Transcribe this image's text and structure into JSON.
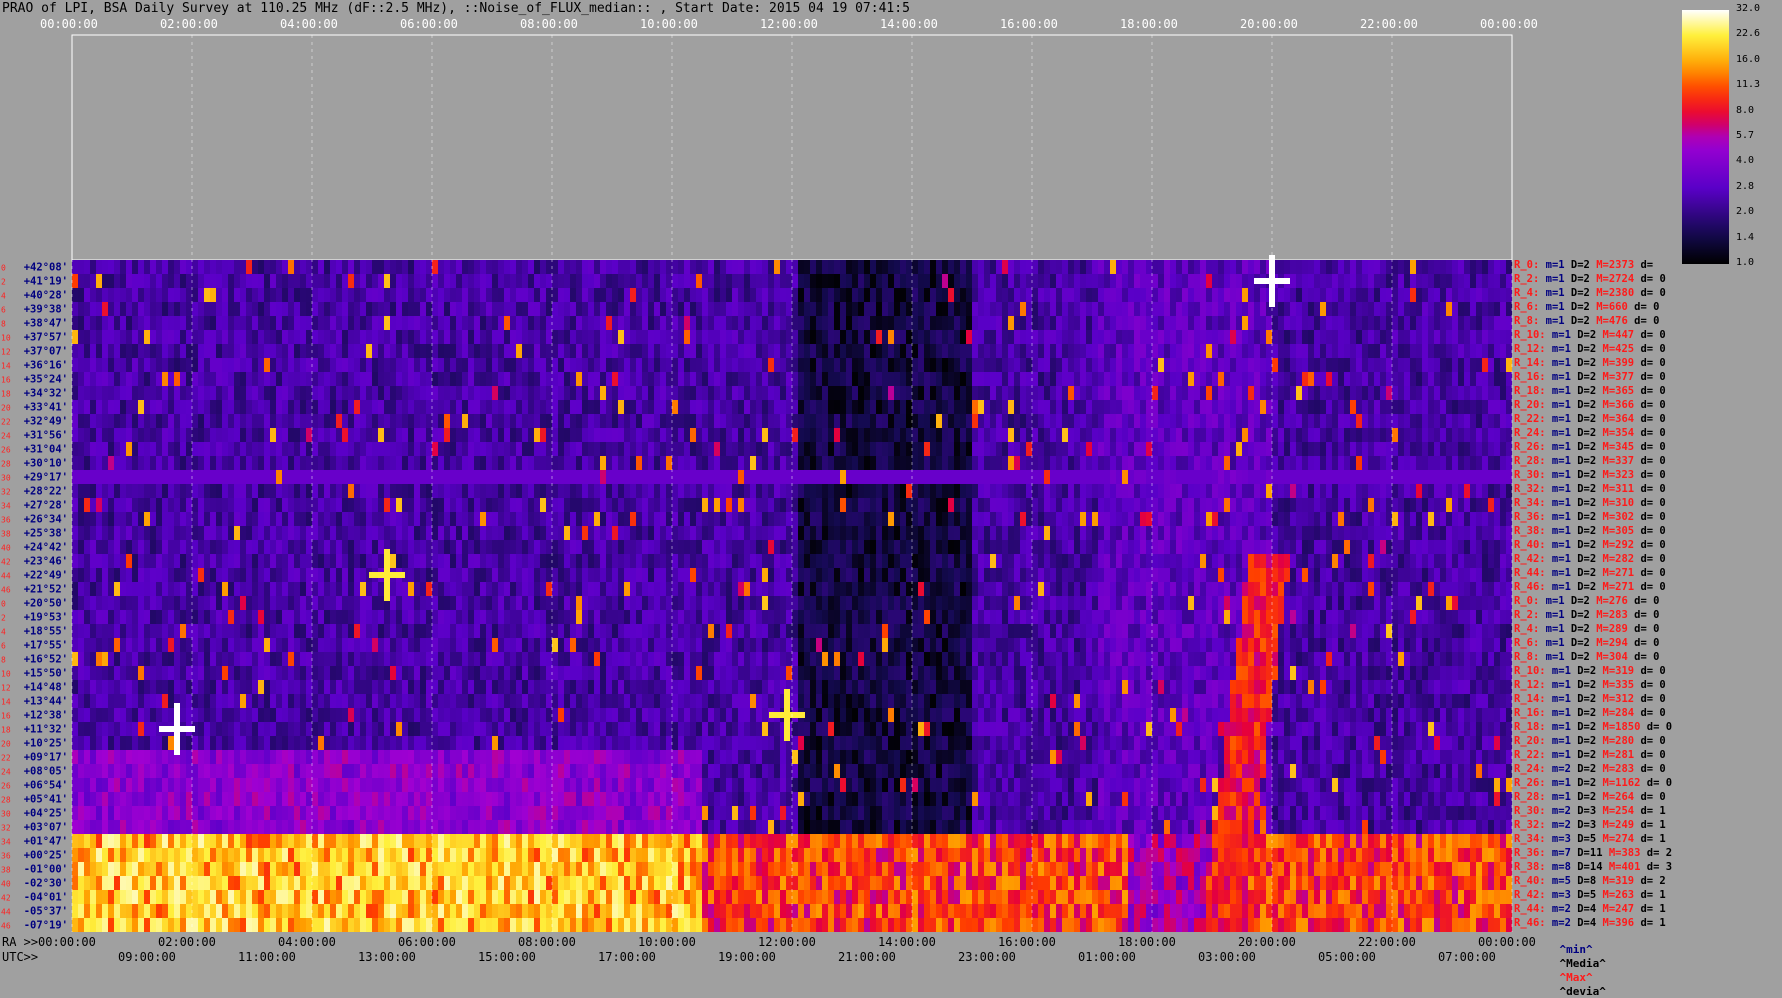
{
  "title": "PRAO of LPI, BSA Daily Survey at 110.25 MHz (dF::2.5 MHz), ::Noise_of_FLUX_median:: , Start Date: 2015 04 19 07:41:5",
  "ra_top_ticks": [
    "00:00:00",
    "02:00:00",
    "04:00:00",
    "06:00:00",
    "08:00:00",
    "10:00:00",
    "12:00:00",
    "14:00:00",
    "16:00:00",
    "18:00:00",
    "20:00:00",
    "22:00:00",
    "00:00:00"
  ],
  "ra_bottom_label": "RA >>",
  "ra_bottom_ticks": [
    "00:00:00",
    "02:00:00",
    "04:00:00",
    "06:00:00",
    "08:00:00",
    "10:00:00",
    "12:00:00",
    "14:00:00",
    "16:00:00",
    "18:00:00",
    "20:00:00",
    "22:00:00",
    "00:00:00"
  ],
  "utc_label": "UTC>>",
  "utc_ticks": [
    "09:00:00",
    "11:00:00",
    "13:00:00",
    "15:00:00",
    "17:00:00",
    "19:00:00",
    "21:00:00",
    "23:00:00",
    "01:00:00",
    "03:00:00",
    "05:00:00",
    "07:00:00"
  ],
  "colorbar_ticks": [
    "32.0",
    "22.6",
    "16.0",
    "11.3",
    "8.0",
    "5.7",
    "4.0",
    "2.8",
    "2.0",
    "1.4",
    "1.0"
  ],
  "colors": {
    "background": "#a0a0a0",
    "dec_label": "#000080",
    "row_label": "#ff2020"
  },
  "legend": {
    "min": "^min^",
    "median": "^Media^",
    "max": "^Max^",
    "dev": "^devia^"
  },
  "chart_data": {
    "type": "heatmap",
    "declinations": [
      "+42°08'",
      "+41°19'",
      "+40°28'",
      "+39°38'",
      "+38°47'",
      "+37°57'",
      "+37°07'",
      "+36°16'",
      "+35°24'",
      "+34°32'",
      "+33°41'",
      "+32°49'",
      "+31°56'",
      "+31°04'",
      "+30°10'",
      "+29°17'",
      "+28°22'",
      "+27°28'",
      "+26°34'",
      "+25°38'",
      "+24°42'",
      "+23°46'",
      "+22°49'",
      "+21°52'",
      "+20°50'",
      "+19°53'",
      "+18°55'",
      "+17°55'",
      "+16°52'",
      "+15°50'",
      "+14°48'",
      "+13°44'",
      "+12°38'",
      "+11°32'",
      "+10°25'",
      "+09°17'",
      "+08°05'",
      "+06°54'",
      "+05°41'",
      "+04°25'",
      "+03°07'",
      "+01°47'",
      "+00°25'",
      "-01°00'",
      "-02°30'",
      "-04°01'",
      "-05°37'",
      "-07°19'"
    ],
    "row_numbers": [
      "0",
      "2",
      "4",
      "6",
      "8",
      "10",
      "12",
      "14",
      "16",
      "18",
      "20",
      "22",
      "24",
      "26",
      "28",
      "30",
      "32",
      "34",
      "36",
      "38",
      "40",
      "42",
      "44",
      "46",
      "0",
      "2",
      "4",
      "6",
      "8",
      "10",
      "12",
      "14",
      "16",
      "18",
      "20",
      "22",
      "24",
      "26",
      "28",
      "30",
      "32",
      "34",
      "36",
      "38",
      "40",
      "42",
      "44",
      "46"
    ],
    "stats": [
      {
        "r": "R_0:",
        "m": "m=1",
        "D": "D=2",
        "M": "M=2373",
        "d": "d="
      },
      {
        "r": "R_2:",
        "m": "m=1",
        "D": "D=2",
        "M": "M=2724",
        "d": "d= 0"
      },
      {
        "r": "R_4:",
        "m": "m=1",
        "D": "D=2",
        "M": "M=2380",
        "d": "d= 0"
      },
      {
        "r": "R_6:",
        "m": "m=1",
        "D": "D=2",
        "M": "M=660",
        "d": "d= 0"
      },
      {
        "r": "R_8:",
        "m": "m=1",
        "D": "D=2",
        "M": "M=476",
        "d": "d= 0"
      },
      {
        "r": "R_10:",
        "m": "m=1",
        "D": "D=2",
        "M": "M=447",
        "d": "d= 0"
      },
      {
        "r": "R_12:",
        "m": "m=1",
        "D": "D=2",
        "M": "M=425",
        "d": "d= 0"
      },
      {
        "r": "R_14:",
        "m": "m=1",
        "D": "D=2",
        "M": "M=399",
        "d": "d= 0"
      },
      {
        "r": "R_16:",
        "m": "m=1",
        "D": "D=2",
        "M": "M=377",
        "d": "d= 0"
      },
      {
        "r": "R_18:",
        "m": "m=1",
        "D": "D=2",
        "M": "M=365",
        "d": "d= 0"
      },
      {
        "r": "R_20:",
        "m": "m=1",
        "D": "D=2",
        "M": "M=366",
        "d": "d= 0"
      },
      {
        "r": "R_22:",
        "m": "m=1",
        "D": "D=2",
        "M": "M=364",
        "d": "d= 0"
      },
      {
        "r": "R_24:",
        "m": "m=1",
        "D": "D=2",
        "M": "M=354",
        "d": "d= 0"
      },
      {
        "r": "R_26:",
        "m": "m=1",
        "D": "D=2",
        "M": "M=345",
        "d": "d= 0"
      },
      {
        "r": "R_28:",
        "m": "m=1",
        "D": "D=2",
        "M": "M=337",
        "d": "d= 0"
      },
      {
        "r": "R_30:",
        "m": "m=1",
        "D": "D=2",
        "M": "M=323",
        "d": "d= 0"
      },
      {
        "r": "R_32:",
        "m": "m=1",
        "D": "D=2",
        "M": "M=311",
        "d": "d= 0"
      },
      {
        "r": "R_34:",
        "m": "m=1",
        "D": "D=2",
        "M": "M=310",
        "d": "d= 0"
      },
      {
        "r": "R_36:",
        "m": "m=1",
        "D": "D=2",
        "M": "M=302",
        "d": "d= 0"
      },
      {
        "r": "R_38:",
        "m": "m=1",
        "D": "D=2",
        "M": "M=305",
        "d": "d= 0"
      },
      {
        "r": "R_40:",
        "m": "m=1",
        "D": "D=2",
        "M": "M=292",
        "d": "d= 0"
      },
      {
        "r": "R_42:",
        "m": "m=1",
        "D": "D=2",
        "M": "M=282",
        "d": "d= 0"
      },
      {
        "r": "R_44:",
        "m": "m=1",
        "D": "D=2",
        "M": "M=271",
        "d": "d= 0"
      },
      {
        "r": "R_46:",
        "m": "m=1",
        "D": "D=2",
        "M": "M=271",
        "d": "d= 0"
      },
      {
        "r": "R_0:",
        "m": "m=1",
        "D": "D=2",
        "M": "M=276",
        "d": "d= 0"
      },
      {
        "r": "R_2:",
        "m": "m=1",
        "D": "D=2",
        "M": "M=283",
        "d": "d= 0"
      },
      {
        "r": "R_4:",
        "m": "m=1",
        "D": "D=2",
        "M": "M=289",
        "d": "d= 0"
      },
      {
        "r": "R_6:",
        "m": "m=1",
        "D": "D=2",
        "M": "M=294",
        "d": "d= 0"
      },
      {
        "r": "R_8:",
        "m": "m=1",
        "D": "D=2",
        "M": "M=304",
        "d": "d= 0"
      },
      {
        "r": "R_10:",
        "m": "m=1",
        "D": "D=2",
        "M": "M=319",
        "d": "d= 0"
      },
      {
        "r": "R_12:",
        "m": "m=1",
        "D": "D=2",
        "M": "M=335",
        "d": "d= 0"
      },
      {
        "r": "R_14:",
        "m": "m=1",
        "D": "D=2",
        "M": "M=312",
        "d": "d= 0"
      },
      {
        "r": "R_16:",
        "m": "m=1",
        "D": "D=2",
        "M": "M=284",
        "d": "d= 0"
      },
      {
        "r": "R_18:",
        "m": "m=1",
        "D": "D=2",
        "M": "M=1850",
        "d": "d= 0"
      },
      {
        "r": "R_20:",
        "m": "m=1",
        "D": "D=2",
        "M": "M=280",
        "d": "d= 0"
      },
      {
        "r": "R_22:",
        "m": "m=1",
        "D": "D=2",
        "M": "M=281",
        "d": "d= 0"
      },
      {
        "r": "R_24:",
        "m": "m=2",
        "D": "D=2",
        "M": "M=283",
        "d": "d= 0"
      },
      {
        "r": "R_26:",
        "m": "m=1",
        "D": "D=2",
        "M": "M=1162",
        "d": "d= 0"
      },
      {
        "r": "R_28:",
        "m": "m=1",
        "D": "D=2",
        "M": "M=264",
        "d": "d= 0"
      },
      {
        "r": "R_30:",
        "m": "m=2",
        "D": "D=3",
        "M": "M=254",
        "d": "d= 1"
      },
      {
        "r": "R_32:",
        "m": "m=2",
        "D": "D=3",
        "M": "M=249",
        "d": "d= 1"
      },
      {
        "r": "R_34:",
        "m": "m=3",
        "D": "D=5",
        "M": "M=274",
        "d": "d= 1"
      },
      {
        "r": "R_36:",
        "m": "m=7",
        "D": "D=11",
        "M": "M=383",
        "d": "d= 2"
      },
      {
        "r": "R_38:",
        "m": "m=8",
        "D": "D=14",
        "M": "M=401",
        "d": "d= 3"
      },
      {
        "r": "R_40:",
        "m": "m=5",
        "D": "D=8",
        "M": "M=319",
        "d": "d= 2"
      },
      {
        "r": "R_42:",
        "m": "m=3",
        "D": "D=5",
        "M": "M=263",
        "d": "d= 1"
      },
      {
        "r": "R_44:",
        "m": "m=2",
        "D": "D=4",
        "M": "M=247",
        "d": "d= 1"
      },
      {
        "r": "R_46:",
        "m": "m=2",
        "D": "D=4",
        "M": "M=396",
        "d": "d= 1"
      }
    ],
    "x_range_hours": [
      0,
      24
    ],
    "colorbar_range": [
      1.0,
      32.0
    ],
    "colorbar_scale": "log",
    "features": [
      {
        "name": "bright band",
        "dec_from": "+01°47'",
        "dec_to": "-07°19'",
        "peak_value": 32
      },
      {
        "name": "bright source",
        "ra": "01:45:00",
        "dec": "+11°32'",
        "value": 32
      },
      {
        "name": "bright source",
        "ra": "20:00:00",
        "dec": "+41°19'",
        "value": 32
      },
      {
        "name": "bright source",
        "ra": "05:15:00",
        "dec": "+22°49'",
        "value": 22
      },
      {
        "name": "bright source",
        "ra": "11:55:00",
        "dec": "+12°38'",
        "value": 22
      }
    ]
  }
}
